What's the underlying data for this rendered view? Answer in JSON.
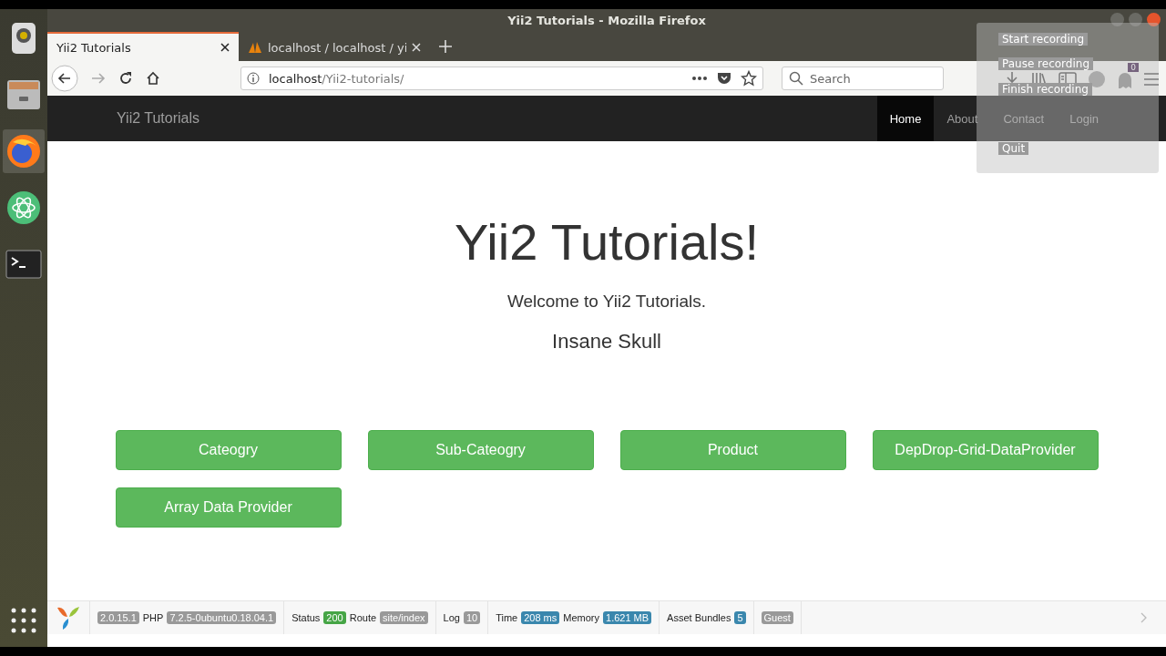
{
  "window": {
    "title": "Yii2 Tutorials - Mozilla Firefox"
  },
  "dock": [
    {
      "kind": "speaker",
      "selected": false
    },
    {
      "kind": "files",
      "selected": false
    },
    {
      "kind": "browser",
      "selected": true
    },
    {
      "kind": "atom",
      "selected": false
    },
    {
      "kind": "terminal",
      "selected": false
    }
  ],
  "tabs": [
    {
      "label": "Yii2 Tutorials",
      "selected": true,
      "kind": "plain"
    },
    {
      "label": "localhost / localhost / yi",
      "selected": false,
      "kind": "db"
    }
  ],
  "address": {
    "host": "localhost",
    "path": "/Yii2-tutorials/"
  },
  "search": {
    "placeholder": "Search"
  },
  "addon_badge": "0",
  "recording_menu": [
    "Start recording",
    "Pause recording",
    "Finish recording",
    "Quit"
  ],
  "navbar": {
    "brand": "Yii2 Tutorials",
    "items": [
      {
        "label": "Home",
        "selected": true
      },
      {
        "label": "About",
        "selected": false
      },
      {
        "label": "Contact",
        "selected": false
      },
      {
        "label": "Login",
        "selected": false
      }
    ]
  },
  "hero": {
    "title": "Yii2 Tutorials!",
    "lead": "Welcome to Yii2 Tutorials.",
    "name": "Insane Skull"
  },
  "buttons": [
    "Cateogry",
    "Sub-Cateogry",
    "Product",
    "DepDrop-Grid-DataProvider",
    "Array Data Provider"
  ],
  "debug_toolbar": [
    {
      "items": [
        {
          "kind": "badge",
          "text": "2.0.15.1",
          "color": "#999999"
        },
        {
          "kind": "label",
          "text": "PHP"
        },
        {
          "kind": "badge",
          "text": "7.2.5-0ubuntu0.18.04.1",
          "color": "#999999"
        }
      ]
    },
    {
      "items": [
        {
          "kind": "label",
          "text": "Status"
        },
        {
          "kind": "badge",
          "text": "200",
          "color": "#46a546"
        },
        {
          "kind": "label",
          "text": "Route"
        },
        {
          "kind": "badge",
          "text": "site/index",
          "color": "#999999"
        }
      ]
    },
    {
      "items": [
        {
          "kind": "label",
          "text": "Log"
        },
        {
          "kind": "badge",
          "text": "10",
          "color": "#999999"
        }
      ]
    },
    {
      "items": [
        {
          "kind": "label",
          "text": "Time"
        },
        {
          "kind": "badge",
          "text": "208 ms",
          "color": "#3a87ad"
        },
        {
          "kind": "label",
          "text": "Memory"
        },
        {
          "kind": "badge",
          "text": "1.621 MB",
          "color": "#3a87ad"
        }
      ]
    },
    {
      "items": [
        {
          "kind": "label",
          "text": "Asset Bundles"
        },
        {
          "kind": "badge",
          "text": "5",
          "color": "#3a87ad"
        }
      ]
    },
    {
      "items": [
        {
          "kind": "badge",
          "text": "Guest",
          "color": "#999999"
        }
      ]
    }
  ]
}
